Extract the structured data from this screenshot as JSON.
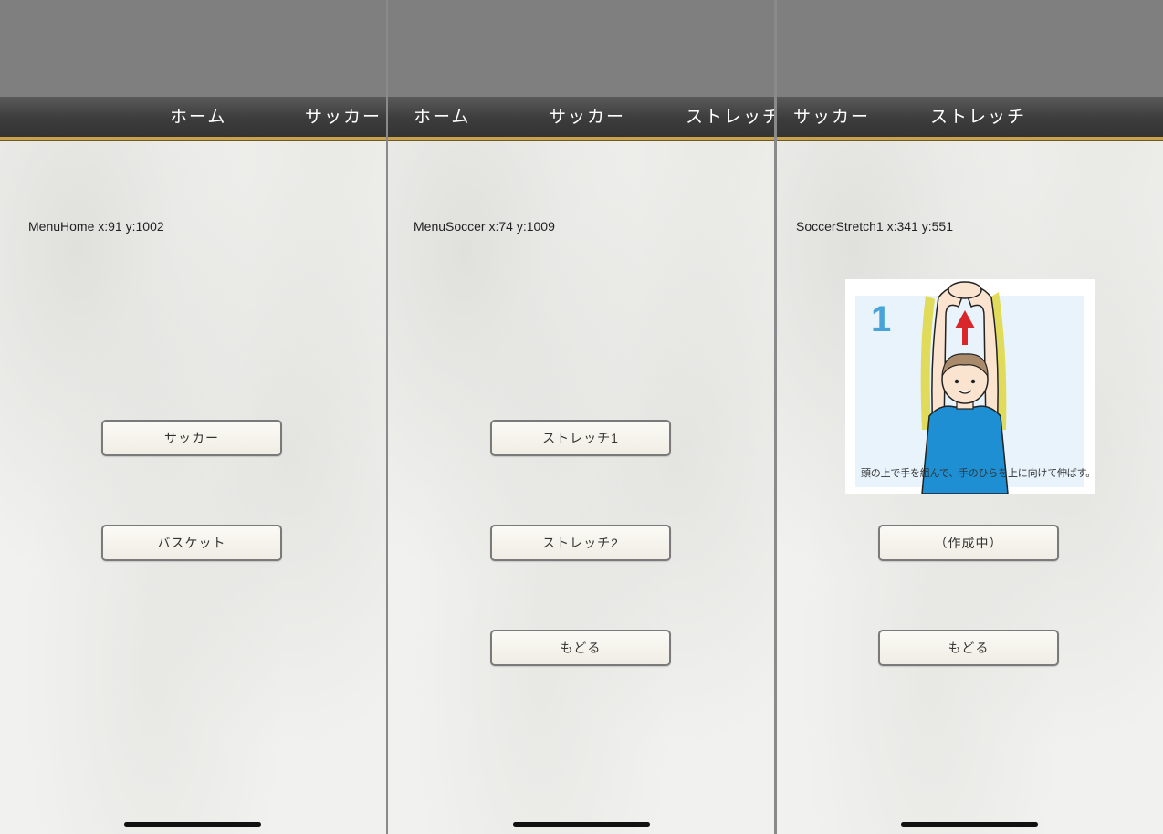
{
  "screens": [
    {
      "nav": {
        "center": "ホーム",
        "right": "サッカー"
      },
      "debug_label": "MenuHome x:91 y:1002",
      "buttons": [
        "サッカー",
        "バスケット"
      ]
    },
    {
      "nav": {
        "left": "ホーム",
        "center": "サッカー",
        "right": "ストレッチ"
      },
      "debug_label": "MenuSoccer x:74 y:1009",
      "buttons": [
        "ストレッチ1",
        "ストレッチ2",
        "もどる"
      ]
    },
    {
      "nav": {
        "left": "サッカー",
        "center": "ストレッチ"
      },
      "debug_label": "SoccerStretch1 x:341 y:551",
      "illustration": {
        "step_number": "1",
        "caption": "頭の上で手を組んで、手のひらを上に向けて伸ばす。"
      },
      "buttons": [
        "（作成中）",
        "もどる"
      ]
    }
  ],
  "colors": {
    "navbar": "#3c3c3c",
    "navbar_accent": "#c9a24a",
    "illustration_bg": "#e8f3fb",
    "step_number": "#4aa3d6",
    "shirt": "#1e8fd2",
    "arrow": "#d9262b",
    "stretch_highlight": "#e0d84a"
  }
}
